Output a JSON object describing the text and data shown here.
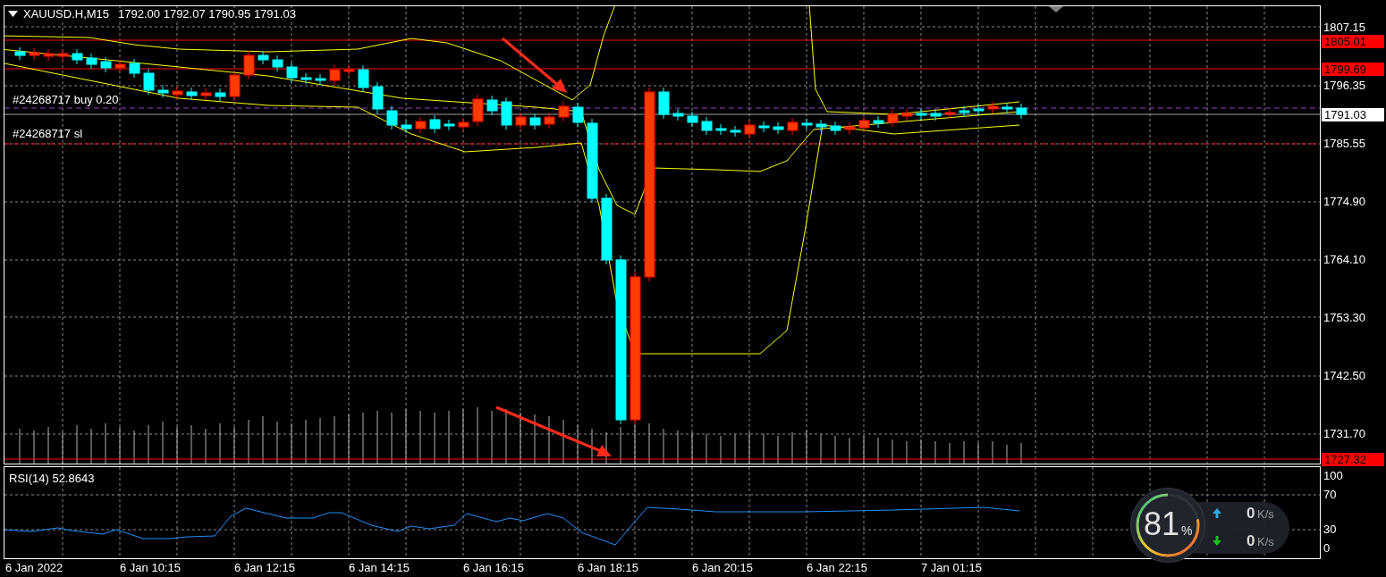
{
  "chart": {
    "symbol": "XAUUSD.H,M15",
    "ohlc": "1792.00 1792.07 1790.95 1791.03",
    "trade_labels": [
      {
        "label": "#24268717 buy 0.20",
        "kind": "entry"
      },
      {
        "label": "#24268717 sl",
        "kind": "stop"
      }
    ],
    "price_ticks": [
      "1807.15",
      "1796.35",
      "1785.55",
      "1774.90",
      "1764.10",
      "1753.30",
      "1742.50",
      "1731.70"
    ],
    "price_markers": [
      {
        "label": "1805.01",
        "kind": "order"
      },
      {
        "label": "1799.69",
        "kind": "order"
      },
      {
        "label": "1791.03",
        "kind": "bid"
      },
      {
        "label": "1727.32",
        "kind": "order"
      }
    ]
  },
  "rsi": {
    "label": "RSI(14) 52.8643",
    "ticks": [
      "100",
      "70",
      "30",
      "0"
    ]
  },
  "time_axis": [
    "6 Jan 2022",
    "6 Jan 10:15",
    "6 Jan 12:15",
    "6 Jan 14:15",
    "6 Jan 16:15",
    "6 Jan 18:15",
    "6 Jan 20:15",
    "6 Jan 22:15",
    "7 Jan 01:15"
  ],
  "widget": {
    "percent": "81",
    "unit": "%",
    "upload": {
      "value": "0",
      "unit": "K/s"
    },
    "download": {
      "value": "0",
      "unit": "K/s"
    }
  }
}
